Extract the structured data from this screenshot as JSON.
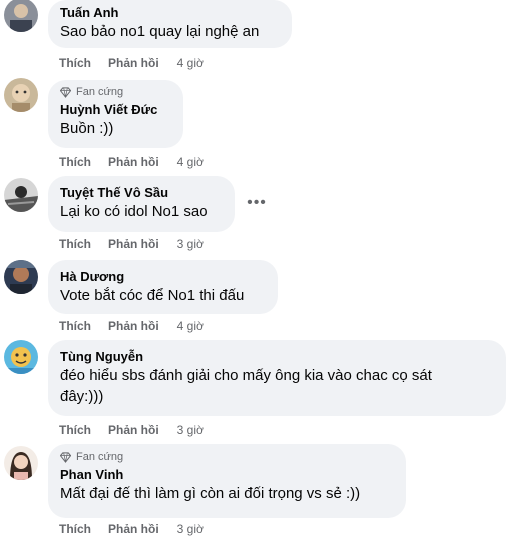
{
  "comments": [
    {
      "author": "Tuấn Anh",
      "badge": "",
      "text": "Sao bảo no1 quay lại nghệ an",
      "like": "Thích",
      "reply": "Phản hồi",
      "time": "4 giờ"
    },
    {
      "author": "Huỳnh Viết Đức",
      "badge": "Fan cứng",
      "text": "Buồn :))",
      "like": "Thích",
      "reply": "Phản hồi",
      "time": "4 giờ"
    },
    {
      "author": "Tuyệt Thế Vô Sầu",
      "badge": "",
      "text": "Lại ko có idol No1 sao",
      "like": "Thích",
      "reply": "Phản hồi",
      "time": "3 giờ",
      "more": "•••"
    },
    {
      "author": "Hà Dương",
      "badge": "",
      "text": "Vote bắt cóc để No1 thi đấu",
      "like": "Thích",
      "reply": "Phản hồi",
      "time": "4 giờ"
    },
    {
      "author": "Tùng Nguyễn",
      "badge": "",
      "text": "đéo hiểu sbs đánh giải cho mấy ông kia vào chac cọ sát\nđây:)))",
      "like": "Thích",
      "reply": "Phản hồi",
      "time": "3 giờ"
    },
    {
      "author": "Phan Vinh",
      "badge": "Fan cứng",
      "text": "Mất đại đế thì làm gì còn ai đối trọng vs sẻ :))",
      "like": "Thích",
      "reply": "Phản hồi",
      "time": "3 giờ"
    }
  ]
}
